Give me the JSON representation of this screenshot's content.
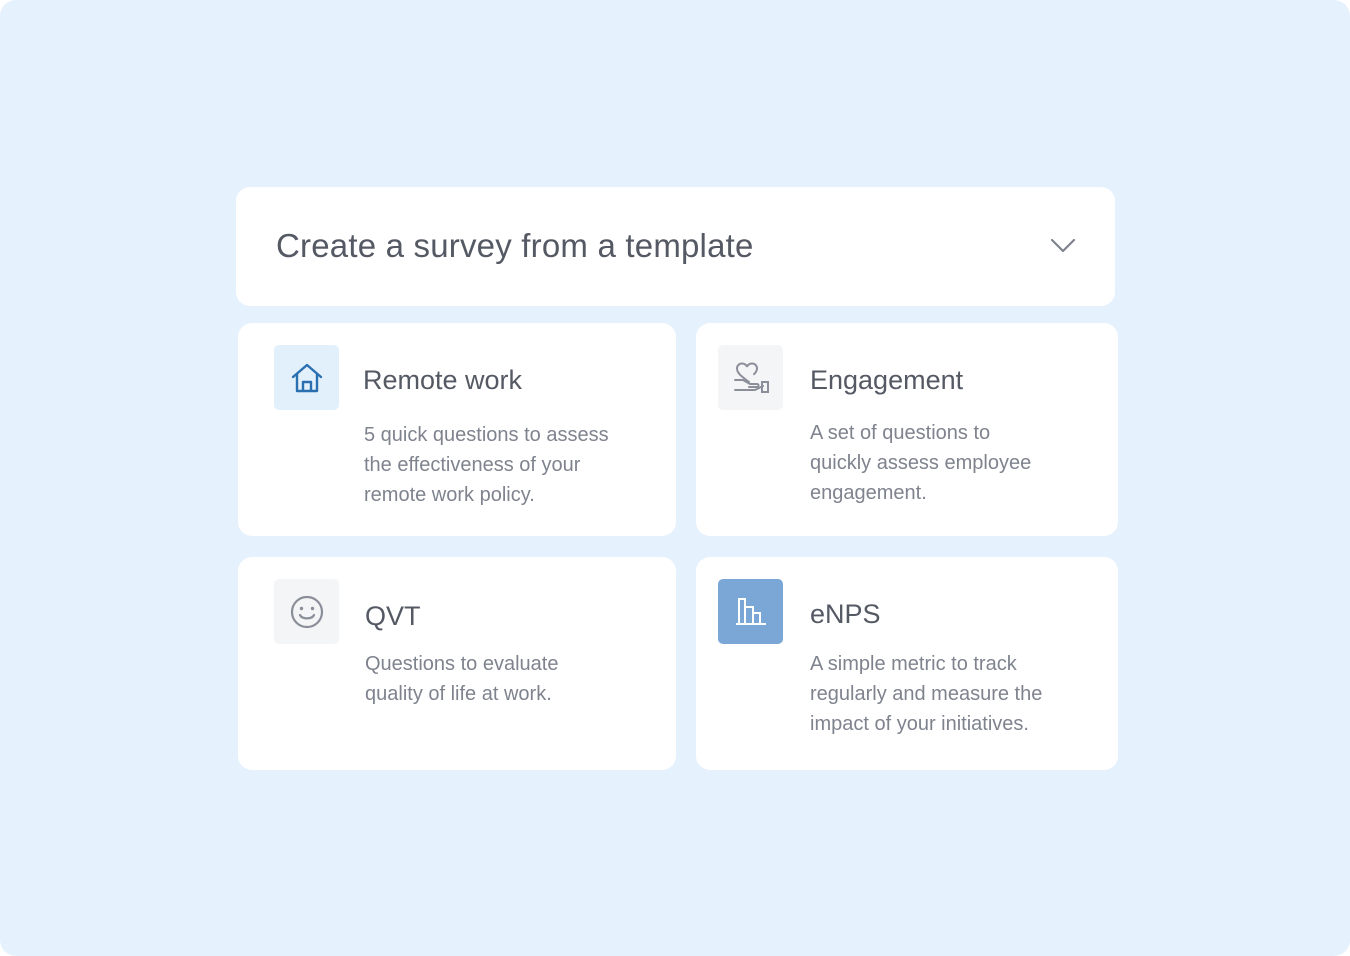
{
  "header": {
    "title": "Create a survey from a template",
    "toggle_icon": "chevron-down-icon"
  },
  "templates": [
    {
      "title": "Remote work",
      "description": "5 quick questions to assess\nthe effectiveness of your\nremote work policy.",
      "icon": "house-icon",
      "icon_bg": "#e2f0fc",
      "icon_color": "#2a6fb0"
    },
    {
      "title": "Engagement",
      "description": "A set of questions to\nquickly assess employee\nengagement.",
      "icon": "heart-hand-icon",
      "icon_bg": "#f4f5f7",
      "icon_color": "#8a8f99"
    },
    {
      "title": "QVT",
      "description": "Questions to evaluate\nquality of life at work.",
      "icon": "smiley-icon",
      "icon_bg": "#f4f5f7",
      "icon_color": "#8a8f99"
    },
    {
      "title": "eNPS",
      "description": "A simple metric to track\nregularly and measure the\nimpact of your initiatives.",
      "icon": "bar-chart-icon",
      "icon_bg": "#7aa7d6",
      "icon_color": "#ffffff"
    }
  ],
  "colors": {
    "background": "#e5f1fd",
    "card": "#ffffff",
    "title_text": "#545964",
    "body_text": "#7e838e"
  }
}
